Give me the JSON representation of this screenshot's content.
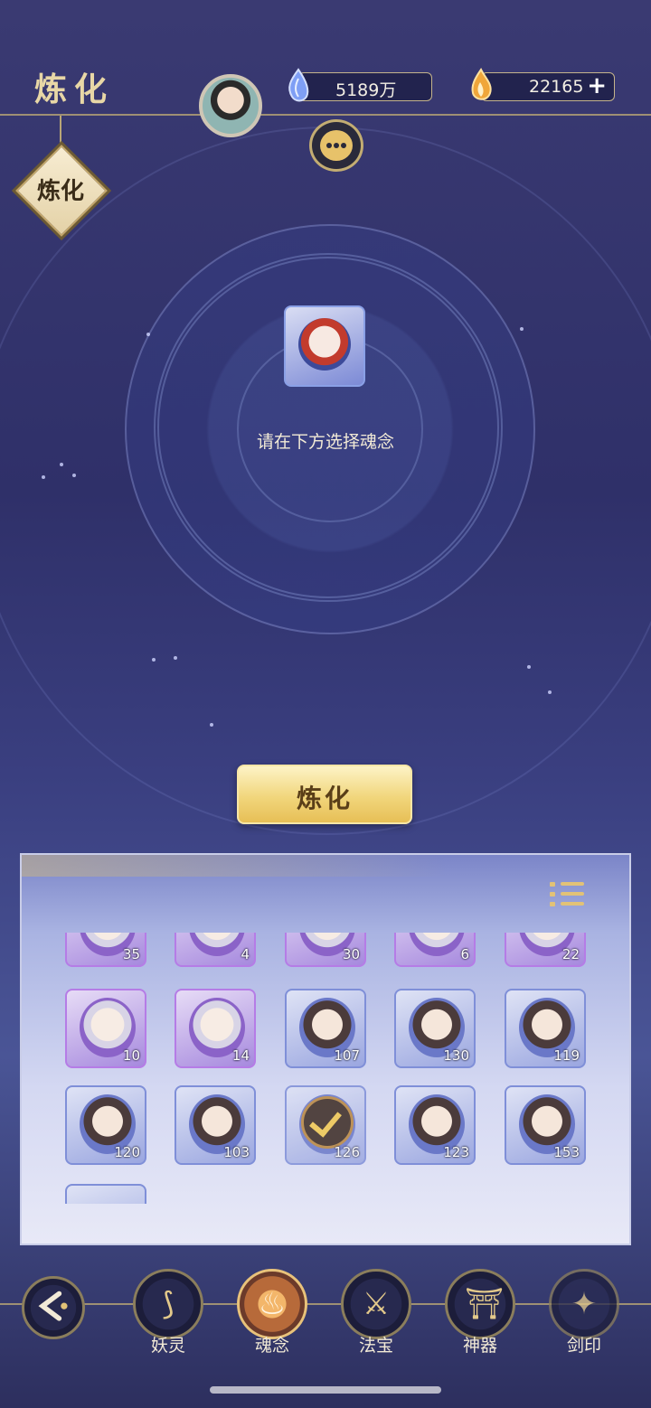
{
  "header": {
    "title": "炼化",
    "resources": [
      {
        "icon": "spirit-crystal-icon",
        "value": "5189万"
      },
      {
        "icon": "ember-icon",
        "value": "22165"
      }
    ],
    "plus_label": "+"
  },
  "side_tag": {
    "label": "炼化"
  },
  "altar": {
    "prompt": "请在下方选择魂念"
  },
  "action": {
    "refine_label": "炼化"
  },
  "inventory": {
    "rows": [
      [
        "35",
        "4",
        "30",
        "6",
        "22"
      ],
      [
        "10",
        "14",
        "107",
        "130",
        "119"
      ],
      [
        "120",
        "103",
        "126",
        "123",
        "153"
      ]
    ],
    "selected_level": "126"
  },
  "nav": {
    "items": [
      {
        "label": "妖灵",
        "icon": "fox-spirit-icon"
      },
      {
        "label": "魂念",
        "icon": "soul-flame-icon"
      },
      {
        "label": "法宝",
        "icon": "magic-treasure-icon"
      },
      {
        "label": "神器",
        "icon": "artifact-pagoda-icon"
      },
      {
        "label": "剑印",
        "icon": "sword-seal-icon"
      }
    ],
    "active": "魂念"
  },
  "colors": {
    "accent_gold": "#e2c277",
    "panel_blue": "#7f8fd8",
    "rare_purple": "#b57ce6"
  }
}
